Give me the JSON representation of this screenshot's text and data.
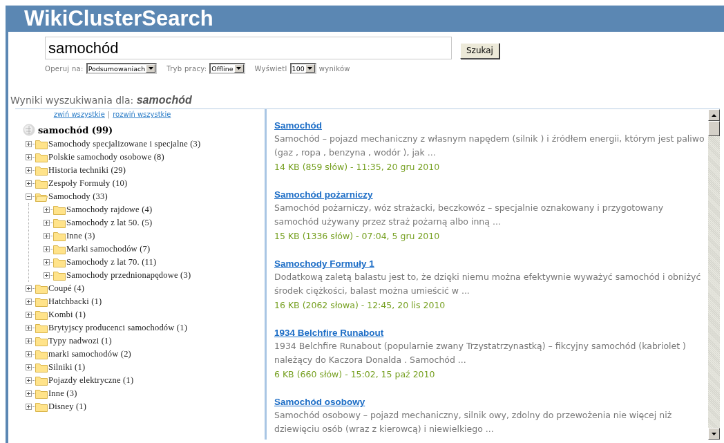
{
  "header": {
    "title": "WikiClusterSearch"
  },
  "search": {
    "value": "samochód",
    "button": "Szukaj"
  },
  "options": [
    {
      "label": "Operuj na:",
      "value": "Podsumowaniach"
    },
    {
      "label": "Tryb pracy:",
      "value": "Offline"
    },
    {
      "label": "Wyświetl",
      "value": "100",
      "suffix": "wyników"
    }
  ],
  "results_heading": "Wyniki wyszukiwania dla: *samochód*",
  "tree": {
    "collapse_all": "zwiń wszystkie",
    "separator": "|",
    "expand_all": "rozwiń wszystkie",
    "root": {
      "label": "samochód (99)"
    },
    "items": [
      {
        "label": "Samochody specjalizowane i specjalne (3)",
        "expanded": false
      },
      {
        "label": "Polskie samochody osobowe (8)",
        "expanded": false
      },
      {
        "label": "Historia techniki (29)",
        "expanded": false
      },
      {
        "label": "Zespoły Formuły (10)",
        "expanded": false
      },
      {
        "label": "Samochody (33)",
        "expanded": true,
        "children": [
          {
            "label": "Samochody rajdowe (4)",
            "expanded": false
          },
          {
            "label": "Samochody z lat 50. (5)",
            "expanded": false
          },
          {
            "label": "Inne (3)",
            "expanded": false
          },
          {
            "label": "Marki samochodów (7)",
            "expanded": false
          },
          {
            "label": "Samochody z lat 70. (11)",
            "expanded": false
          },
          {
            "label": "Samochody przednionapędowe (3)",
            "expanded": false
          }
        ]
      },
      {
        "label": "Coupé (4)",
        "expanded": false
      },
      {
        "label": "Hatchbacki (1)",
        "expanded": false
      },
      {
        "label": "Kombi (1)",
        "expanded": false
      },
      {
        "label": "Brytyjscy producenci samochodów (1)",
        "expanded": false
      },
      {
        "label": "Typy nadwozi (1)",
        "expanded": false
      },
      {
        "label": "marki samochodów (2)",
        "expanded": false
      },
      {
        "label": "Silniki (1)",
        "expanded": false
      },
      {
        "label": "Pojazdy elektryczne (1)",
        "expanded": false
      },
      {
        "label": "Inne (3)",
        "expanded": false
      },
      {
        "label": "Disney (1)",
        "expanded": false
      }
    ]
  },
  "results": [
    {
      "title": "Samochód",
      "snippet": "Samochód – pojazd mechaniczny z własnym napędem (silnik ) i źródłem energii, którym jest paliwo (gaz , ropa , benzyna , wodór ), jak ...",
      "meta": "14 KB (859 słów) - 11:35, 20 gru 2010"
    },
    {
      "title": "Samochód pożarniczy",
      "snippet": "Samochód pożarniczy, wóz strażacki, beczkowóz – specjalnie oznakowany i przygotowany samochód używany przez straż pożarną albo inną ...",
      "meta": "15 KB (1336 słów) - 07:04, 5 gru 2010"
    },
    {
      "title": "Samochody Formuły 1",
      "snippet": "Dodatkową zaletą balastu jest to, że dzięki niemu można efektywnie wyważyć samochód i obniżyć środek ciężkości, balast można umieścić w ...",
      "meta": "16 KB (2062 słowa) - 12:45, 20 lis 2010"
    },
    {
      "title": "1934 Belchfire Runabout",
      "snippet": "1934 Belchfire Runabout (popularnie zwany Trzystatrzynastką) – fikcyjny samochód (kabriolet ) należący do Kaczora Donalda . Samochód ...",
      "meta": "6 KB (660 słów) - 15:02, 15 paź 2010"
    },
    {
      "title": "Samochód osobowy",
      "snippet": "Samochód osobowy – pojazd mechaniczny, silnik owy, zdolny do przewożenia nie więcej niż dziewięciu osób (wraz z kierowcą) i niewielkiego ..."
    }
  ]
}
